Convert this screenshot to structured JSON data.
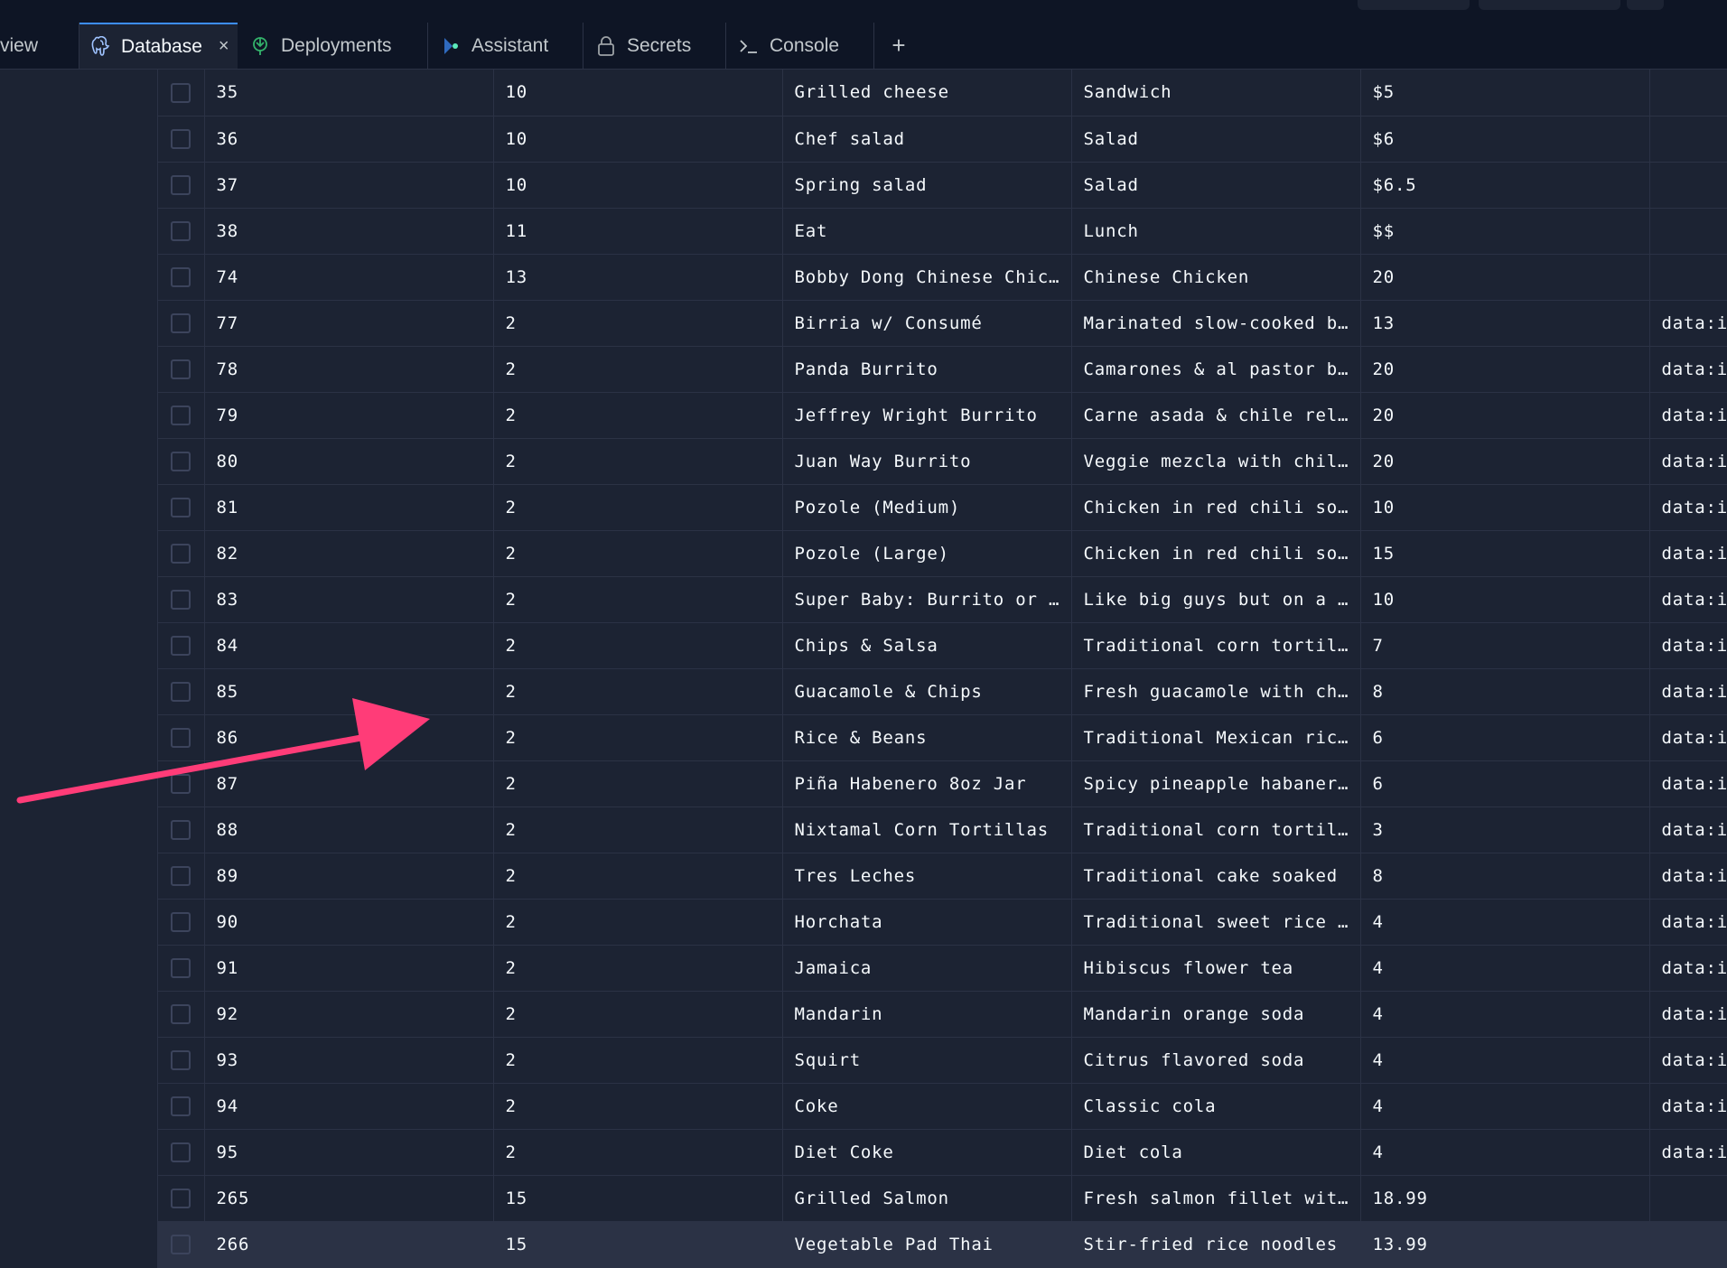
{
  "tabs": [
    {
      "name": "tab-overview",
      "label": "view",
      "icon": ""
    },
    {
      "name": "tab-database",
      "label": "Database",
      "icon": "postgres-elephant-icon",
      "active": true,
      "closable": true
    },
    {
      "name": "tab-deployments",
      "label": "Deployments",
      "icon": "deployments-icon"
    },
    {
      "name": "tab-assistant",
      "label": "Assistant",
      "icon": "assistant-icon"
    },
    {
      "name": "tab-secrets",
      "label": "Secrets",
      "icon": "lock-icon"
    },
    {
      "name": "tab-console",
      "label": "Console",
      "icon": "terminal-prompt-icon"
    }
  ],
  "close_glyph": "×",
  "new_tab_glyph": "+",
  "colors": {
    "background": "#1c2333",
    "chrome": "#0e1525",
    "border": "#2b3245",
    "accent": "#3d8eff",
    "annotation_arrow": "#ff3c78"
  },
  "table": {
    "rows": [
      [
        "35",
        "10",
        "Grilled cheese",
        "Sandwich",
        "$5",
        ""
      ],
      [
        "36",
        "10",
        "Chef salad",
        "Salad",
        "$6",
        ""
      ],
      [
        "37",
        "10",
        "Spring salad",
        "Salad",
        "$6.5",
        ""
      ],
      [
        "38",
        "11",
        "Eat",
        "Lunch",
        "$$",
        ""
      ],
      [
        "74",
        "13",
        "Bobby Dong Chinese Chicken",
        "Chinese Chicken",
        "20",
        ""
      ],
      [
        "77",
        "2",
        "Birria w/ Consumé",
        "Marinated slow-cooked beef",
        "13",
        "data:i"
      ],
      [
        "78",
        "2",
        "Panda Burrito",
        "Camarones & al pastor burrito",
        "20",
        "data:i"
      ],
      [
        "79",
        "2",
        "Jeffrey Wright Burrito",
        "Carne asada & chile relleno",
        "20",
        "data:i"
      ],
      [
        "80",
        "2",
        "Juan Way Burrito",
        "Veggie mezcla with chile",
        "20",
        "data:i"
      ],
      [
        "81",
        "2",
        "Pozole (Medium)",
        "Chicken in red chili soup",
        "10",
        "data:i"
      ],
      [
        "82",
        "2",
        "Pozole (Large)",
        "Chicken in red chili soup",
        "15",
        "data:i"
      ],
      [
        "83",
        "2",
        "Super Baby: Burrito or Taco",
        "Like big guys but on a budget",
        "10",
        "data:i"
      ],
      [
        "84",
        "2",
        "Chips & Salsa",
        "Traditional corn tortilla chips",
        "7",
        "data:i"
      ],
      [
        "85",
        "2",
        "Guacamole & Chips",
        "Fresh guacamole with chips",
        "8",
        "data:i"
      ],
      [
        "86",
        "2",
        "Rice & Beans",
        "Traditional Mexican rice",
        "6",
        "data:i"
      ],
      [
        "87",
        "2",
        "Piña Habenero 8oz Jar",
        "Spicy pineapple habanero",
        "6",
        "data:i"
      ],
      [
        "88",
        "2",
        "Nixtamal Corn Tortillas",
        "Traditional corn tortillas",
        "3",
        "data:i"
      ],
      [
        "89",
        "2",
        "Tres Leches",
        "Traditional cake soaked",
        "8",
        "data:i"
      ],
      [
        "90",
        "2",
        "Horchata",
        "Traditional sweet rice drink",
        "4",
        "data:i"
      ],
      [
        "91",
        "2",
        "Jamaica",
        "Hibiscus flower tea",
        "4",
        "data:i"
      ],
      [
        "92",
        "2",
        "Mandarin",
        "Mandarin orange soda",
        "4",
        "data:i"
      ],
      [
        "93",
        "2",
        "Squirt",
        "Citrus flavored soda",
        "4",
        "data:i"
      ],
      [
        "94",
        "2",
        "Coke",
        "Classic cola",
        "4",
        "data:i"
      ],
      [
        "95",
        "2",
        "Diet Coke",
        "Diet cola",
        "4",
        "data:i"
      ],
      [
        "265",
        "15",
        "Grilled Salmon",
        "Fresh salmon fillet with",
        "18.99",
        ""
      ],
      [
        "266",
        "15",
        "Vegetable Pad Thai",
        "Stir-fried rice noodles",
        "13.99",
        ""
      ]
    ],
    "highlighted_row_index": 25
  }
}
